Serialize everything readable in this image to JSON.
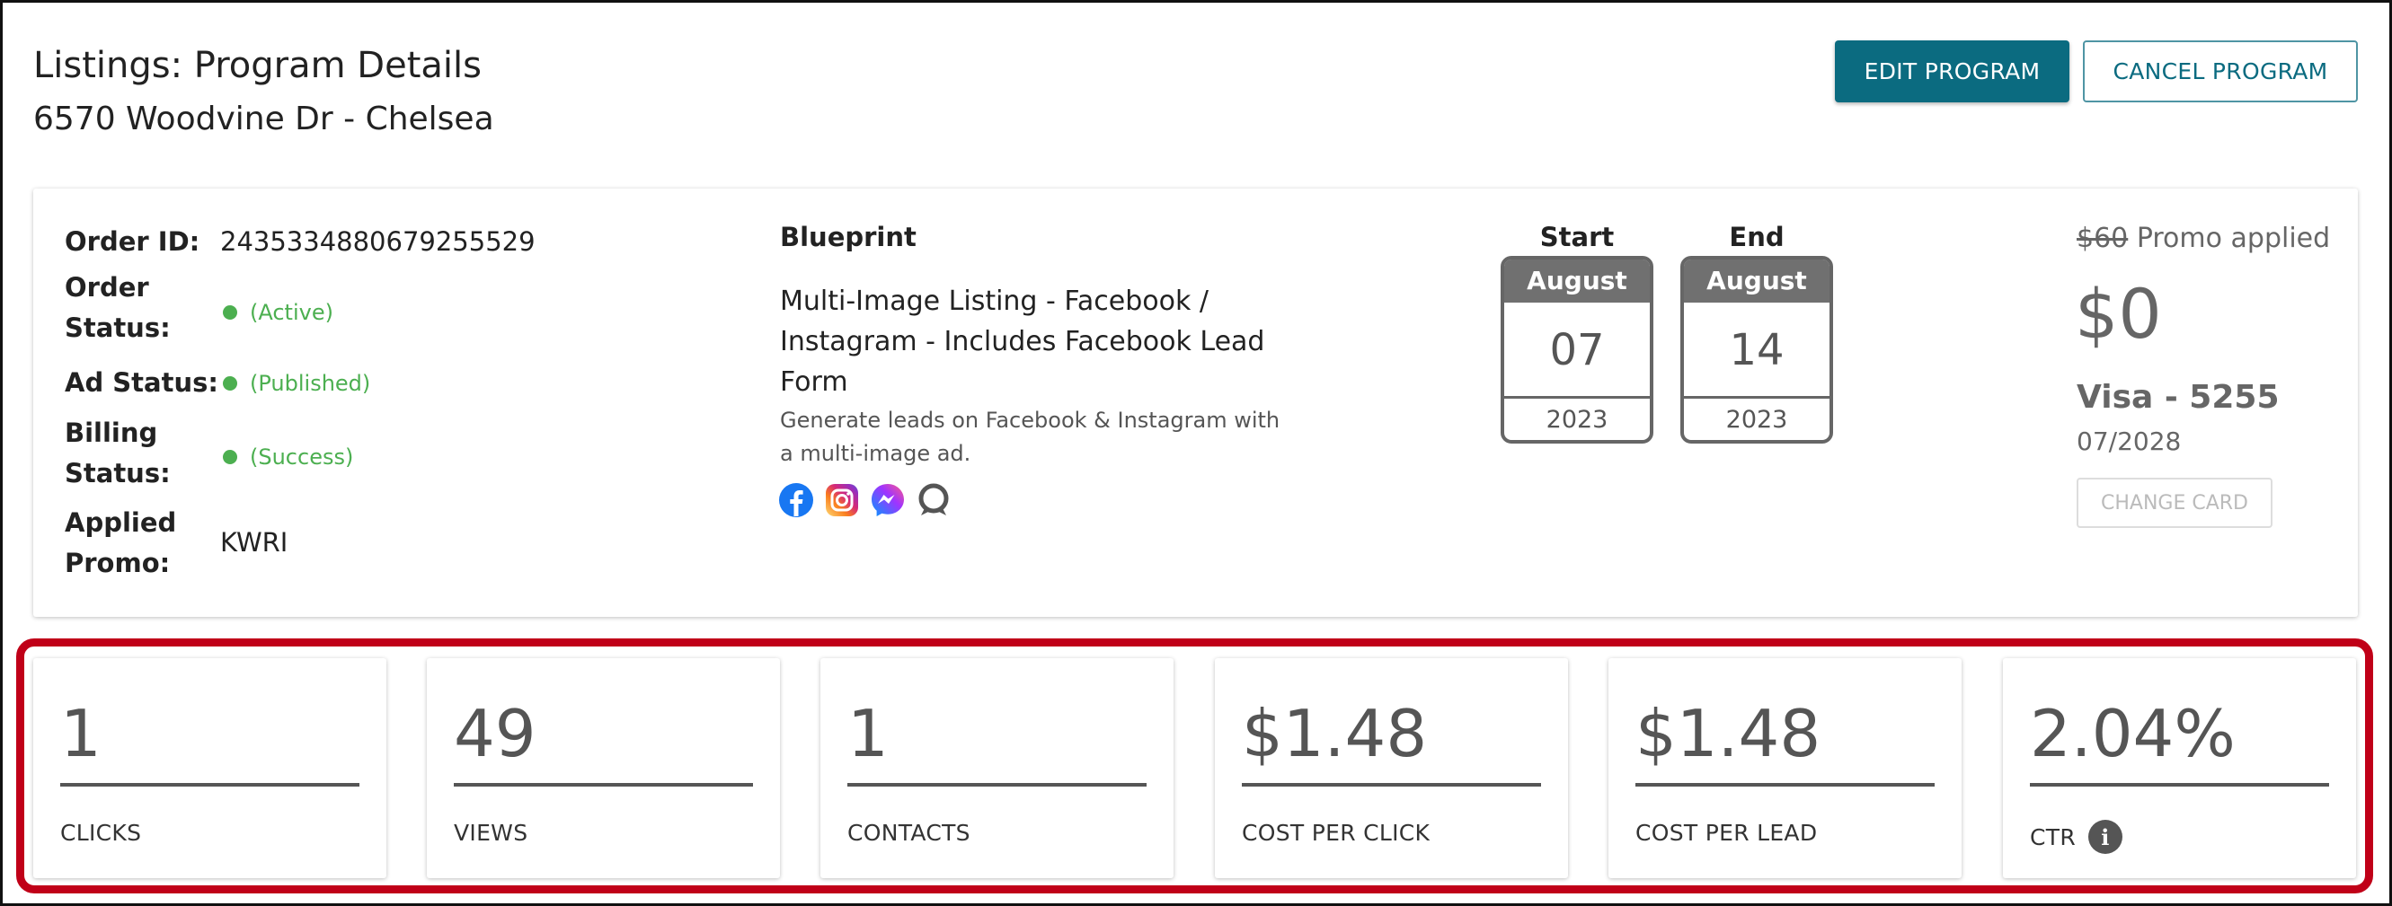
{
  "header": {
    "title": "Listings: Program Details",
    "subtitle": "6570 Woodvine Dr - Chelsea",
    "edit_label": "EDIT PROGRAM",
    "cancel_label": "CANCEL PROGRAM"
  },
  "order": {
    "order_id_label": "Order ID:",
    "order_id": "2435334880679255529",
    "order_status_label_1": "Order",
    "order_status_label_2": "Status:",
    "order_status": "(Active)",
    "ad_status_label": "Ad Status:",
    "ad_status": "(Published)",
    "billing_status_label_1": "Billing",
    "billing_status_label_2": "Status:",
    "billing_status": "(Success)",
    "promo_label_1": "Applied",
    "promo_label_2": "Promo:",
    "promo": "KWRI",
    "status_color": "#4caf50"
  },
  "blueprint": {
    "heading": "Blueprint",
    "name": "Multi-Image Listing - Facebook / Instagram - Includes Facebook Lead Form",
    "description": "Generate leads on Facebook & Instagram with a multi-image ad.",
    "icons": [
      "facebook-icon",
      "instagram-icon",
      "messenger-icon",
      "chat-icon"
    ]
  },
  "schedule": {
    "start": {
      "heading": "Start",
      "month": "August",
      "day": "07",
      "year": "2023"
    },
    "end": {
      "heading": "End",
      "month": "August",
      "day": "14",
      "year": "2023"
    }
  },
  "billing": {
    "original_price": "$60",
    "promo_text": "Promo applied",
    "price": "$0",
    "card": "Visa - 5255",
    "expiry": "07/2028",
    "change_card_label": "CHANGE CARD"
  },
  "metrics": [
    {
      "value": "1",
      "label": "CLICKS"
    },
    {
      "value": "49",
      "label": "VIEWS"
    },
    {
      "value": "1",
      "label": "CONTACTS"
    },
    {
      "value": "$1.48",
      "label": "COST PER CLICK"
    },
    {
      "value": "$1.48",
      "label": "COST PER LEAD"
    },
    {
      "value": "2.04%",
      "label": "CTR",
      "info_icon": "info-icon"
    }
  ],
  "colors": {
    "accent": "#0b6b80",
    "highlight": "#c00018"
  }
}
